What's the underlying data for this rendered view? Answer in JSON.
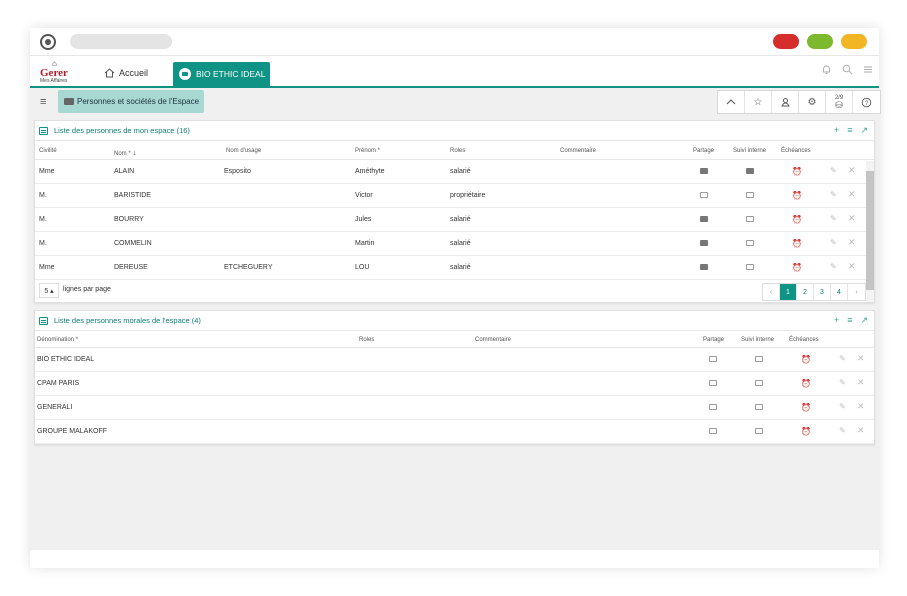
{
  "app": {
    "logo_top": "⌂",
    "logo_main": "Gerer",
    "logo_sub": "Mes Affaires"
  },
  "nav": {
    "home_label": "Accueil",
    "active_tab_label": "BIO ETHIC IDEAL",
    "right_icons": [
      "bell-icon",
      "search-icon",
      "menu-icon"
    ]
  },
  "breadcrumb": {
    "label": "Personnes et sociétés de l'Espace"
  },
  "toolbar": {
    "icons": [
      "chevron-up-icon",
      "star-icon",
      "user-card-icon",
      "settings-icon",
      "coins-icon",
      "help-icon"
    ],
    "coins_badge": "2/9"
  },
  "persons": {
    "title": "Liste des personnes de mon espace (16)",
    "columns": {
      "civilite": "Civilité",
      "nom": "Nom *",
      "nom_usage": "Nom d'usage",
      "prenom": "Prénom *",
      "roles": "Roles",
      "commentaire": "Commentaire",
      "partage": "Partage",
      "suivi": "Suivi interne",
      "echeances": "Échéances"
    },
    "rows": [
      {
        "civilite": "Mme",
        "nom": "ALAIN",
        "nom_usage": "Esposito",
        "prenom": "Améthyte",
        "roles": "salarié",
        "commentaire": "",
        "partage": "filled",
        "suivi": "filled"
      },
      {
        "civilite": "M.",
        "nom": "BARISTIDE",
        "nom_usage": "",
        "prenom": "Victor",
        "roles": "propriétaire",
        "commentaire": "",
        "partage": "outline",
        "suivi": "outline"
      },
      {
        "civilite": "M.",
        "nom": "BOURRY",
        "nom_usage": "",
        "prenom": "Jules",
        "roles": "salarié",
        "commentaire": "",
        "partage": "filled",
        "suivi": "outline"
      },
      {
        "civilite": "M.",
        "nom": "COMMELIN",
        "nom_usage": "",
        "prenom": "Martin",
        "roles": "salarié",
        "commentaire": "",
        "partage": "filled",
        "suivi": "outline"
      },
      {
        "civilite": "Mme",
        "nom": "DEREUSE",
        "nom_usage": "ETCHEGUERY",
        "prenom": "LOU",
        "roles": "salarié",
        "commentaire": "",
        "partage": "filled",
        "suivi": "outline"
      }
    ],
    "per_page": "5 ▴",
    "per_page_label": "lignes par page",
    "pages": [
      "‹",
      "1",
      "2",
      "3",
      "4",
      "›"
    ],
    "active_page": "1"
  },
  "companies": {
    "title": "Liste des personnes morales de l'espace (4)",
    "columns": {
      "denomination": "Dénomination *",
      "roles": "Roles",
      "commentaire": "Commentaire",
      "partage": "Partage",
      "suivi": "Suivi interne",
      "echeances": "Échéances"
    },
    "rows": [
      {
        "denomination": "BIO ETHIC IDEAL",
        "roles": "",
        "commentaire": ""
      },
      {
        "denomination": "CPAM PARIS",
        "roles": "",
        "commentaire": ""
      },
      {
        "denomination": "GENERALI",
        "roles": "",
        "commentaire": ""
      },
      {
        "denomination": "GROUPE MALAKOFF",
        "roles": "",
        "commentaire": ""
      }
    ]
  },
  "colors": {
    "accent": "#0f9384",
    "crumb_bg": "#a8d8d2",
    "window_red": "#d62d2d",
    "window_green": "#7cb92c",
    "window_yellow": "#f2b624",
    "logo_red": "#b51d2a"
  }
}
